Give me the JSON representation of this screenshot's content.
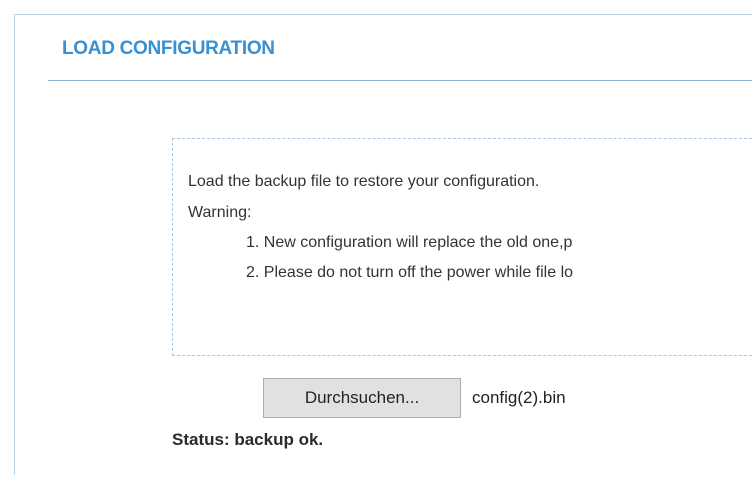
{
  "section": {
    "title": "LOAD CONFIGURATION"
  },
  "info": {
    "intro": "Load the backup file to restore your configuration.",
    "warning_label": "Warning:",
    "items": [
      "1. New configuration will replace the old one,p",
      "2. Please do not turn off the power while file lo"
    ]
  },
  "upload": {
    "browse_label": "Durchsuchen...",
    "file_name": "config(2).bin"
  },
  "status": {
    "text": "Status: backup ok."
  },
  "colors": {
    "title": "#3a8fd0",
    "border": "#b9d2e6",
    "dashed_border": "#a9c6e3"
  }
}
